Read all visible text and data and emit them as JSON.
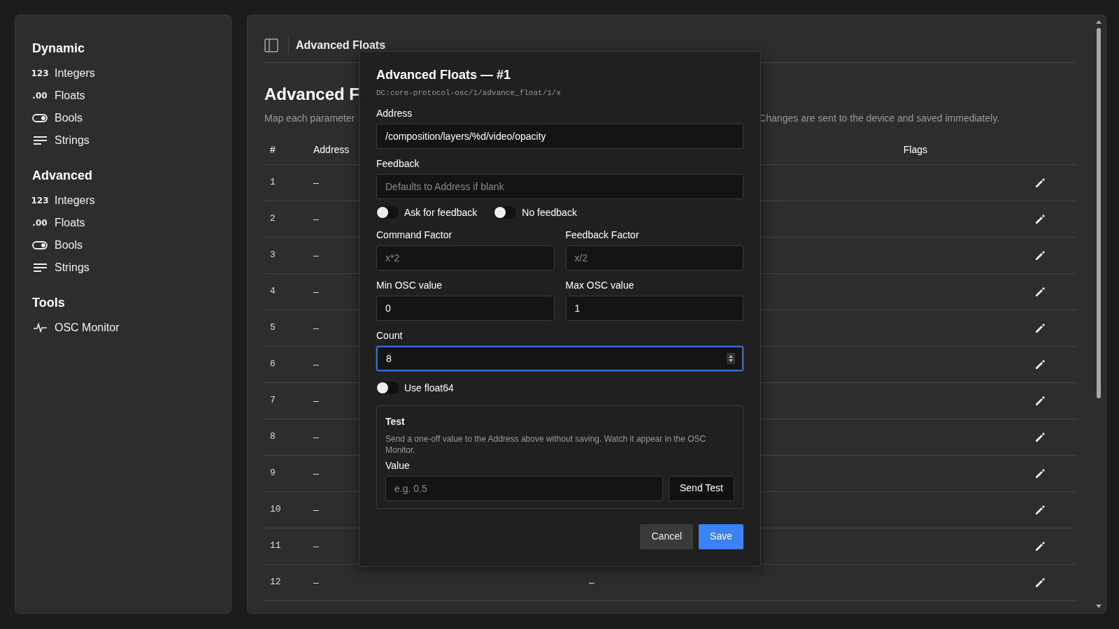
{
  "sidebar": {
    "sections": [
      {
        "title": "Dynamic",
        "items": [
          {
            "kind": "glyph",
            "icon": "123",
            "label": "Integers"
          },
          {
            "kind": "glyph",
            "icon": ".00",
            "label": "Floats"
          },
          {
            "kind": "toggle",
            "label": "Bools"
          },
          {
            "kind": "lines",
            "label": "Strings"
          }
        ]
      },
      {
        "title": "Advanced",
        "items": [
          {
            "kind": "glyph",
            "icon": "123",
            "label": "Integers"
          },
          {
            "kind": "glyph",
            "icon": ".00",
            "label": "Floats"
          },
          {
            "kind": "toggle",
            "label": "Bools"
          },
          {
            "kind": "lines",
            "label": "Strings"
          }
        ]
      },
      {
        "title": "Tools",
        "items": [
          {
            "kind": "pulse",
            "label": "OSC Monitor"
          }
        ]
      }
    ]
  },
  "header": {
    "title": "Advanced Floats"
  },
  "page": {
    "heading": "Advanced F",
    "description_start": "Map each parameter",
    "description_end": "Changes are sent to the device and saved immediately."
  },
  "table": {
    "columns": [
      {
        "kind": "number",
        "label": "#"
      },
      {
        "kind": "text",
        "label": "Address"
      },
      {
        "kind": "hidden"
      },
      {
        "kind": "flags",
        "label": "Flags"
      }
    ],
    "rows": [
      {
        "cells": [
          "1",
          "–"
        ]
      },
      {
        "cells": [
          "2",
          "–"
        ]
      },
      {
        "cells": [
          "3",
          "–"
        ]
      },
      {
        "cells": [
          "4",
          "–"
        ]
      },
      {
        "cells": [
          "5",
          "–"
        ]
      },
      {
        "cells": [
          "6",
          "–"
        ]
      },
      {
        "cells": [
          "7",
          "–"
        ]
      },
      {
        "cells": [
          "8",
          "–"
        ]
      },
      {
        "cells": [
          "9",
          "–"
        ]
      },
      {
        "cells": [
          "10",
          "–"
        ]
      },
      {
        "cells": [
          "11",
          "–"
        ]
      },
      {
        "cells": [
          "12",
          "–",
          "–"
        ]
      }
    ]
  },
  "modal": {
    "title": "Advanced Floats — #1",
    "path": "DC:core-protocol-osc/1/advance_float/1/x",
    "address": {
      "label": "Address",
      "value": "/composition/layers/%d/video/opacity"
    },
    "feedback": {
      "label": "Feedback",
      "placeholder": "Defaults to Address if blank"
    },
    "toggles": [
      {
        "label": "Ask for feedback",
        "on": false
      },
      {
        "label": "No feedback",
        "on": false
      }
    ],
    "factors": [
      {
        "label": "Command Factor",
        "placeholder": "x*2"
      },
      {
        "label": "Feedback Factor",
        "placeholder": "x/2"
      }
    ],
    "limits": [
      {
        "label": "Min OSC value",
        "value": "0"
      },
      {
        "label": "Max OSC value",
        "value": "1"
      }
    ],
    "count": {
      "label": "Count",
      "value": "8",
      "focused": true
    },
    "float64": {
      "label": "Use float64",
      "on": false
    },
    "test": {
      "title": "Test",
      "help": "Send a one-off value to the Address above without saving. Watch it appear in the OSC Monitor.",
      "value_label": "Value",
      "placeholder": "e.g. 0.5",
      "button": "Send Test"
    },
    "buttons": [
      {
        "kind": "secondary",
        "label": "Cancel"
      },
      {
        "kind": "primary",
        "label": "Save"
      }
    ]
  }
}
